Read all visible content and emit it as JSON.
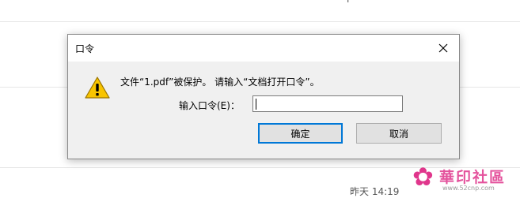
{
  "background": {
    "top_fragment": "l",
    "timestamp": "昨天 14:19"
  },
  "watermark": {
    "title": "華印社區",
    "site": "www.52cnp.com"
  },
  "dialog": {
    "title": "口令",
    "message": "文件“1.pdf”被保护。 请输入“文档打开口令”。",
    "field_label": "输入口令(E)：",
    "password_value": "",
    "ok_label": "确定",
    "cancel_label": "取消",
    "icons": {
      "warning": "warning-icon",
      "close": "close-icon"
    },
    "colors": {
      "focus_border": "#0078d7",
      "warning_fill": "#f8c400"
    }
  }
}
